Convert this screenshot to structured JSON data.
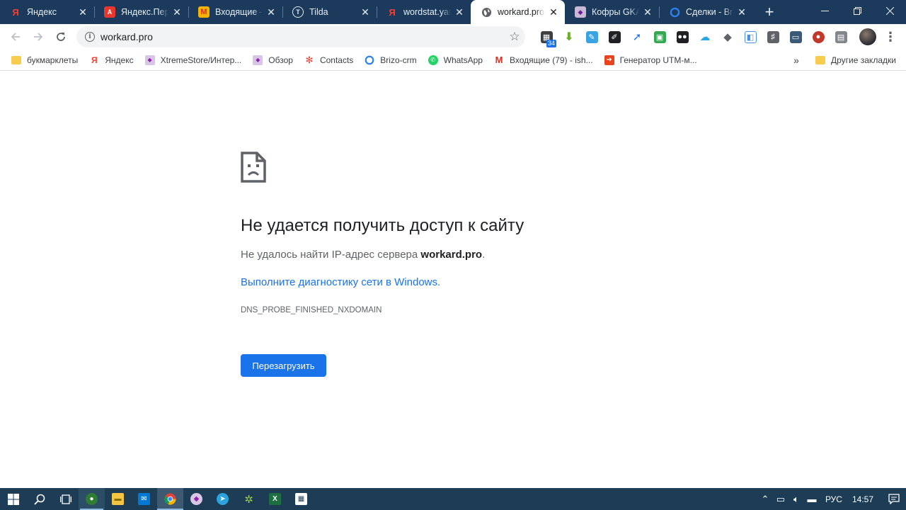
{
  "browser": {
    "tabs": [
      {
        "title": "Яндекс",
        "icon": "yandex-icon",
        "active": false
      },
      {
        "title": "Яндекс.Персональный",
        "icon": "yandex-translate-icon",
        "active": false
      },
      {
        "title": "Входящие – Gmail",
        "icon": "mail-icon",
        "active": false
      },
      {
        "title": "Tilda",
        "icon": "tilda-icon",
        "active": false
      },
      {
        "title": "wordstat.yandex",
        "icon": "yandex-icon",
        "active": false
      },
      {
        "title": "workard.pro",
        "icon": "globe-icon",
        "active": true
      },
      {
        "title": "Кофры GKA",
        "icon": "site-icon",
        "active": false
      },
      {
        "title": "Сделки - Brizo",
        "icon": "brizo-icon",
        "active": false
      }
    ],
    "new_tab_label": "+",
    "close_glyph": "✕",
    "address": {
      "url": "workard.pro"
    },
    "extension_badge": "34",
    "bookmarks": [
      {
        "label": "букмарклеты",
        "icon": "folder-icon"
      },
      {
        "label": "Яндекс",
        "icon": "yandex-icon"
      },
      {
        "label": "XtremeStore/Интер...",
        "icon": "site-icon"
      },
      {
        "label": "Обзор",
        "icon": "site-icon"
      },
      {
        "label": "Contacts",
        "icon": "contacts-icon"
      },
      {
        "label": "Brizo-crm",
        "icon": "brizo-icon"
      },
      {
        "label": "WhatsApp",
        "icon": "whatsapp-icon"
      },
      {
        "label": "Входящие (79) - ish...",
        "icon": "gmail-icon"
      },
      {
        "label": "Генератор UTM-м...",
        "icon": "arrow-icon"
      }
    ],
    "bookmarks_more": "»",
    "other_bookmarks": "Другие закладки"
  },
  "error_page": {
    "title": "Не удается получить доступ к сайту",
    "message_prefix": "Не удалось найти IP-адрес сервера ",
    "message_host": "workard.pro",
    "message_suffix": ".",
    "link_text": "Выполните диагностику сети в Windows",
    "link_suffix": ".",
    "error_code": "DNS_PROBE_FINISHED_NXDOMAIN",
    "reload_label": "Перезагрузить"
  },
  "taskbar": {
    "language": "РУС",
    "time": "14:57"
  },
  "colors": {
    "tabstrip": "#1b3a5c",
    "accent": "#1a73e8",
    "taskbar": "#1d3c55"
  }
}
